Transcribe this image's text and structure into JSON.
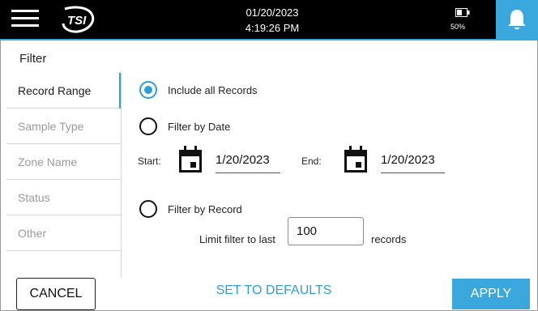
{
  "header": {
    "date": "01/20/2023",
    "time": "4:19:26 PM",
    "battery_percent": "50%",
    "logo_icon": "tsi-logo",
    "menu_icon": "hamburger-menu-icon",
    "alert_icon": "bell-icon",
    "accent_color": "#3aa7dd"
  },
  "page": {
    "title": "Filter"
  },
  "sidebar": {
    "items": [
      {
        "label": "Record Range",
        "active": true
      },
      {
        "label": "Sample Type",
        "active": false
      },
      {
        "label": "Zone Name",
        "active": false
      },
      {
        "label": "Status",
        "active": false
      },
      {
        "label": "Other",
        "active": false
      }
    ]
  },
  "record_range": {
    "all_records": {
      "label": "Include all Records",
      "selected": true
    },
    "by_date": {
      "label": "Filter by Date",
      "selected": false,
      "start_label": "Start:",
      "start_value": "1/20/2023",
      "end_label": "End:",
      "end_value": "1/20/2023",
      "calendar_icon": "calendar-icon"
    },
    "by_record": {
      "label": "Filter by Record",
      "selected": false,
      "limit_label": "Limit filter to last",
      "limit_value": "100",
      "limit_unit": "records"
    }
  },
  "footer": {
    "cancel_label": "CANCEL",
    "defaults_label": "SET TO DEFAULTS",
    "apply_label": "APPLY"
  }
}
